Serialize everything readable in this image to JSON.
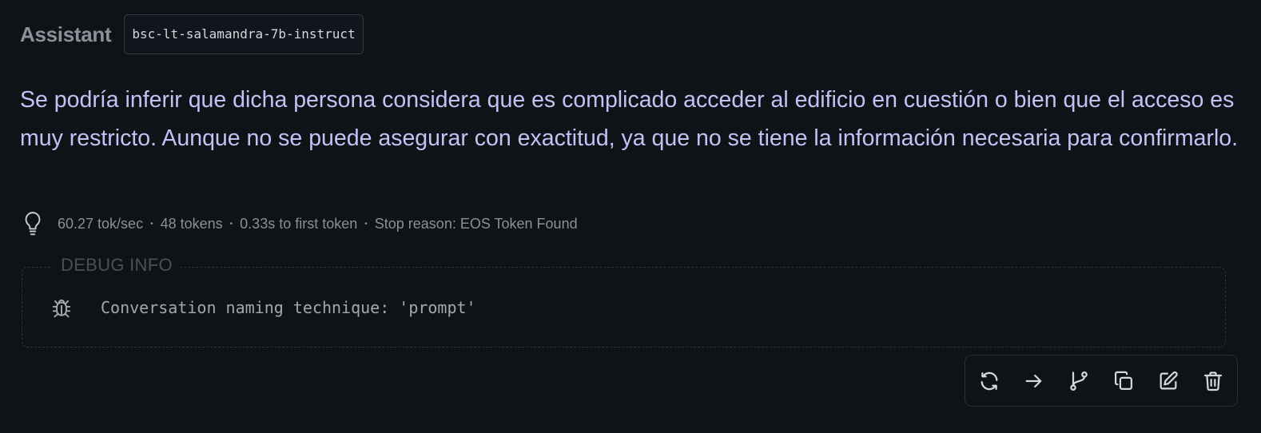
{
  "header": {
    "role": "Assistant",
    "model": "bsc-lt-salamandra-7b-instruct"
  },
  "message": {
    "text": "Se podría inferir que dicha persona considera que es complicado acceder al edificio en cuestión o bien que el acceso es muy restricto. Aunque no se puede asegurar con exactitud, ya que no se tiene la información necesaria para confirmarlo."
  },
  "stats": {
    "icon": "lightbulb-icon",
    "speed": "60.27 tok/sec",
    "tokens": "48 tokens",
    "first_token": "0.33s to first token",
    "stop_reason": "Stop reason: EOS Token Found",
    "separator": "•"
  },
  "debug": {
    "legend": "DEBUG INFO",
    "icon": "bug-icon",
    "line": "Conversation naming technique: 'prompt'"
  },
  "toolbar": {
    "buttons": [
      {
        "icon": "regenerate-icon",
        "name": "regenerate-button"
      },
      {
        "icon": "continue-arrow-icon",
        "name": "continue-button"
      },
      {
        "icon": "branch-icon",
        "name": "branch-button"
      },
      {
        "icon": "copy-icon",
        "name": "copy-button"
      },
      {
        "icon": "edit-icon",
        "name": "edit-button"
      },
      {
        "icon": "trash-icon",
        "name": "delete-button"
      }
    ]
  },
  "colors": {
    "background": "#0f1217",
    "message_text": "#c5c0f5",
    "muted_text": "#8a8f98"
  }
}
